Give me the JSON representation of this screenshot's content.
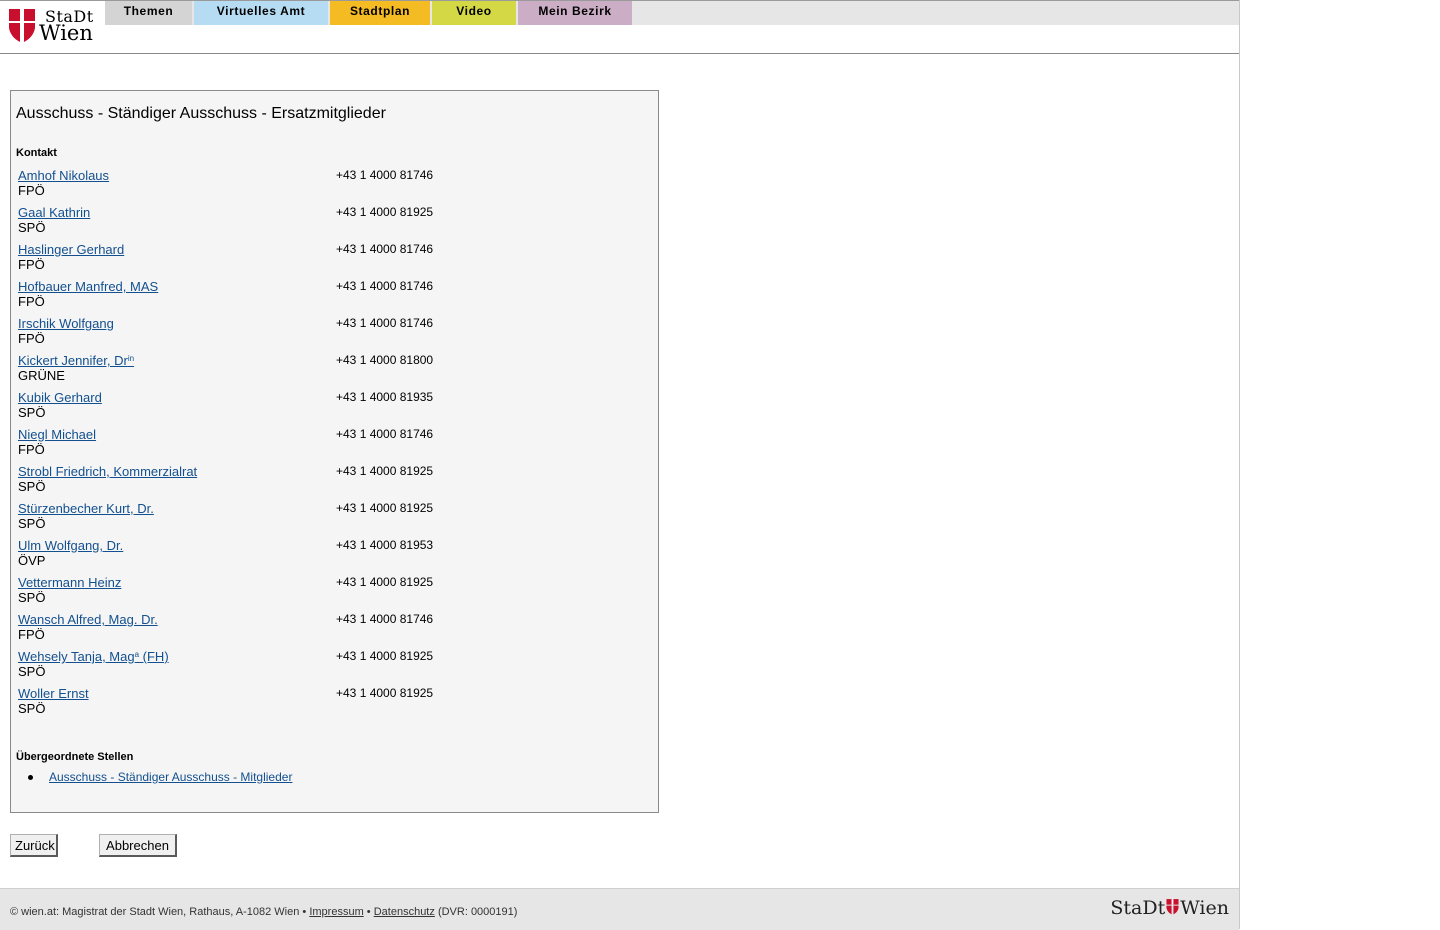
{
  "logo": {
    "line1": "StaDt",
    "line2": "Wien"
  },
  "tabs": [
    {
      "label": "Themen",
      "color": "#d4d4d4"
    },
    {
      "label": "Virtuelles Amt",
      "color": "#b5dcf2"
    },
    {
      "label": "Stadtplan",
      "color": "#f5bb22"
    },
    {
      "label": "Video",
      "color": "#d4d845"
    },
    {
      "label": "Mein Bezirk",
      "color": "#cbadc6"
    }
  ],
  "main": {
    "title": "Ausschuss - Ständiger Ausschuss - Ersatzmitglieder",
    "contact_heading": "Kontakt",
    "contacts": [
      {
        "name": "Amhof Nikolaus",
        "party": "FPÖ",
        "phone": "+43 1 4000 81746"
      },
      {
        "name": "Gaal Kathrin",
        "party": "SPÖ",
        "phone": "+43 1 4000 81925"
      },
      {
        "name": "Haslinger Gerhard",
        "party": "FPÖ",
        "phone": "+43 1 4000 81746"
      },
      {
        "name": "Hofbauer Manfred, MAS",
        "party": "FPÖ",
        "phone": "+43 1 4000 81746"
      },
      {
        "name": "Irschik Wolfgang",
        "party": "FPÖ",
        "phone": "+43 1 4000 81746"
      },
      {
        "name": "Kickert Jennifer, Dr",
        "name_sup": "in",
        "party": "GRÜNE",
        "phone": "+43 1 4000 81800"
      },
      {
        "name": "Kubik Gerhard",
        "party": "SPÖ",
        "phone": "+43 1 4000 81935"
      },
      {
        "name": "Niegl Michael",
        "party": "FPÖ",
        "phone": "+43 1 4000 81746"
      },
      {
        "name": "Strobl Friedrich, Kommerzialrat",
        "party": "SPÖ",
        "phone": "+43 1 4000 81925"
      },
      {
        "name": "Stürzenbecher Kurt, Dr.",
        "party": "SPÖ",
        "phone": "+43 1 4000 81925"
      },
      {
        "name": "Ulm Wolfgang, Dr.",
        "party": "ÖVP",
        "phone": "+43 1 4000 81953"
      },
      {
        "name": "Vettermann Heinz",
        "party": "SPÖ",
        "phone": "+43 1 4000 81925"
      },
      {
        "name": "Wansch Alfred, Mag. Dr.",
        "party": "FPÖ",
        "phone": "+43 1 4000 81746"
      },
      {
        "name": "Wehsely Tanja, Mag",
        "name_sup": "a",
        "name_suffix": " (FH)",
        "party": "SPÖ",
        "phone": "+43 1 4000 81925"
      },
      {
        "name": "Woller Ernst",
        "party": "SPÖ",
        "phone": "+43 1 4000 81925"
      }
    ],
    "parent_heading": "Übergeordnete Stellen",
    "parent_links": [
      "Ausschuss - Ständiger Ausschuss - Mitglieder"
    ]
  },
  "buttons": {
    "back": "Zurück",
    "cancel": "Abbrechen"
  },
  "footer": {
    "prefix": "© wien.at: Magistrat der Stadt Wien, Rathaus, A-1082 Wien •",
    "impressum": "Impressum",
    "sep": "•",
    "datenschutz": "Datenschutz",
    "dvr": "(DVR: 0000191)",
    "logo_left": "StaDt",
    "logo_right": "Wien"
  },
  "colors": {
    "link": "#13508f",
    "shield_red": "#c8102e"
  }
}
